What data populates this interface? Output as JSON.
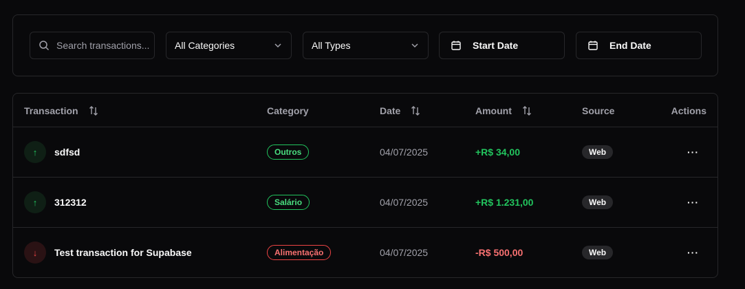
{
  "filters": {
    "search_placeholder": "Search transactions...",
    "category_selected": "All Categories",
    "type_selected": "All Types",
    "start_date_label": "Start Date",
    "end_date_label": "End Date"
  },
  "table": {
    "headers": {
      "transaction": "Transaction",
      "category": "Category",
      "date": "Date",
      "amount": "Amount",
      "source": "Source",
      "actions": "Actions"
    },
    "rows": [
      {
        "direction": "↑",
        "name": "sdfsd",
        "category": "Outros",
        "date": "04/07/2025",
        "amount": "+R$ 34,00",
        "source": "Web",
        "actions": "···"
      },
      {
        "direction": "↑",
        "name": "312312",
        "category": "Salário",
        "date": "04/07/2025",
        "amount": "+R$ 1.231,00",
        "source": "Web",
        "actions": "···"
      },
      {
        "direction": "↓",
        "name": "Test transaction for Supabase",
        "category": "Alimentação",
        "date": "04/07/2025",
        "amount": "-R$ 500,00",
        "source": "Web",
        "actions": "···"
      }
    ]
  },
  "colors": {
    "income": "#22c55e",
    "expense": "#ef4444",
    "background": "#09090b",
    "border": "#27272a"
  }
}
